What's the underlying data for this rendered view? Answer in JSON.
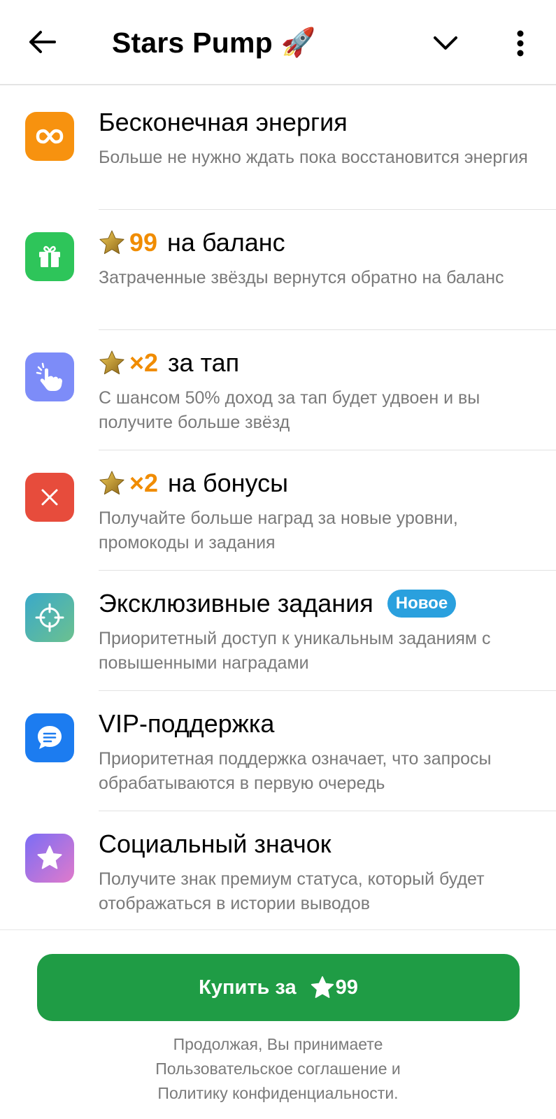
{
  "header": {
    "title": "Stars Pump",
    "title_emoji": "🚀"
  },
  "items": [
    {
      "icon": "infinity-icon",
      "icon_bg": "#f7920f",
      "star_prefix": false,
      "accent": "",
      "title": "Бесконечная энергия",
      "badge": "",
      "desc": "Больше не нужно ждать пока восстановится энергия"
    },
    {
      "icon": "gift-icon",
      "icon_bg": "#2ec55a",
      "star_prefix": true,
      "accent": "99",
      "title": "на баланс",
      "badge": "",
      "desc": "Затраченные звёзды вернутся обратно на баланс"
    },
    {
      "icon": "tap-hand-icon",
      "icon_bg": "#7d8cf8",
      "star_prefix": true,
      "accent": "×2",
      "title": "за тап",
      "badge": "",
      "desc": "С шансом 50% доход за тап будет удвоен и вы получите больше звёзд"
    },
    {
      "icon": "close-x-icon",
      "icon_bg": "#e74c3c",
      "star_prefix": true,
      "accent": "×2",
      "title": "на бонусы",
      "badge": "",
      "desc": "Получайте больше наград за новые уровни, промокоды и задания"
    },
    {
      "icon": "target-icon",
      "icon_bg": "#4fb0a8",
      "star_prefix": false,
      "accent": "",
      "title": "Эксклюзивные задания",
      "badge": "Новое",
      "desc": "Приоритетный доступ к уникальным заданиям с повышенными наградами"
    },
    {
      "icon": "chat-bubble-icon",
      "icon_bg": "#1c7cf0",
      "star_prefix": false,
      "accent": "",
      "title": "VIP-поддержка",
      "badge": "",
      "desc": "Приоритетная поддержка означает, что запросы обрабатываются в первую очередь"
    },
    {
      "icon": "star-badge-icon",
      "icon_bg": "#a66cf0",
      "star_prefix": false,
      "accent": "",
      "title": "Социальный значок",
      "badge": "",
      "desc": "Получите знак премиум статуса, который будет отображаться в истории выводов"
    }
  ],
  "buy_button": {
    "label": "Купить за",
    "price": "99",
    "color": "#1f9c45"
  },
  "terms": {
    "line1": "Продолжая, Вы принимаете",
    "line2": "Пользовательское соглашение и",
    "line3": "Политику конфиденциальности."
  }
}
